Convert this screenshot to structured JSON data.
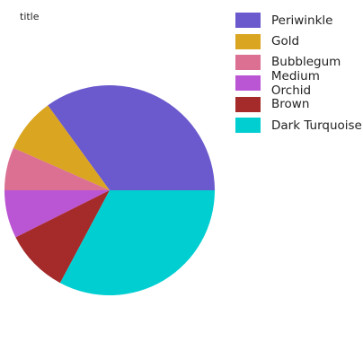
{
  "chart_data": {
    "type": "pie",
    "title": "title",
    "categories": [
      "Periwinkle",
      "Gold",
      "Bubblegum",
      "Medium Orchid",
      "Brown",
      "Dark Turquoise"
    ],
    "values": [
      35.0,
      8.4,
      6.6,
      7.4,
      9.8,
      32.8
    ],
    "colors": [
      "#6A5ACD",
      "#DAA520",
      "#DB7093",
      "#BA55D3",
      "#A52A2A",
      "#00CED1"
    ],
    "legend_position": "right"
  }
}
